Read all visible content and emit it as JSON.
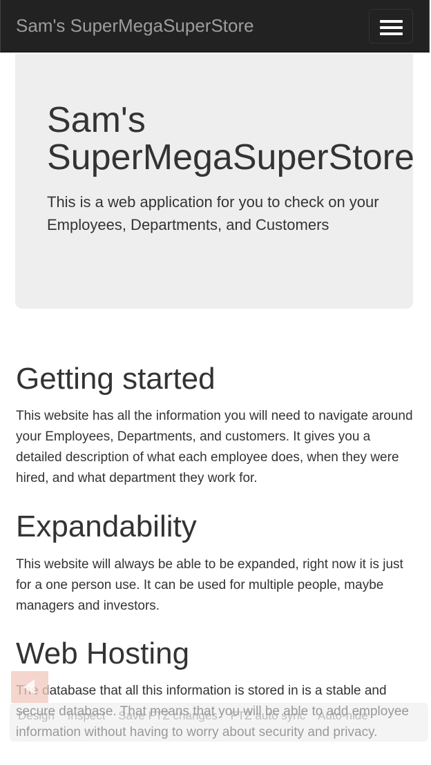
{
  "navbar": {
    "brand": "Sam's SuperMegaSuperStore",
    "toggle_icon": "hamburger-menu-icon"
  },
  "jumbotron": {
    "title_line1": "Sam's",
    "title_line2": "SuperMegaSuperStore",
    "text": "This is a web application for you to check on your Employees, Departments, and Customers"
  },
  "sections": [
    {
      "heading": "Getting started",
      "text": "This website has all the information you will need to navigate around your Employees, Departments, and customers. It gives you a detailed description of what each employee does, when they were hired, and what department they work for."
    },
    {
      "heading": "Expandability",
      "text": "This website will always be able to be expanded, right now it is just for a one person use. It can be used for multiple people, maybe managers and investors."
    },
    {
      "heading": "Web Hosting",
      "text": "The database that all this information is stored in is a stable and secure database. That means that you will be able to add employee information without having to worry about security and privacy."
    }
  ],
  "devbar": {
    "items": [
      "Design",
      "Inspect",
      "Save FTZ changes",
      "FTZ auto sync",
      "Auto-hide"
    ],
    "icon": "collapse-arrow-icon"
  },
  "colors": {
    "navbar_bg": "#222222",
    "brand_text": "#9d9d9d",
    "jumbotron_bg": "#eeeeee",
    "body_text": "#333333"
  }
}
